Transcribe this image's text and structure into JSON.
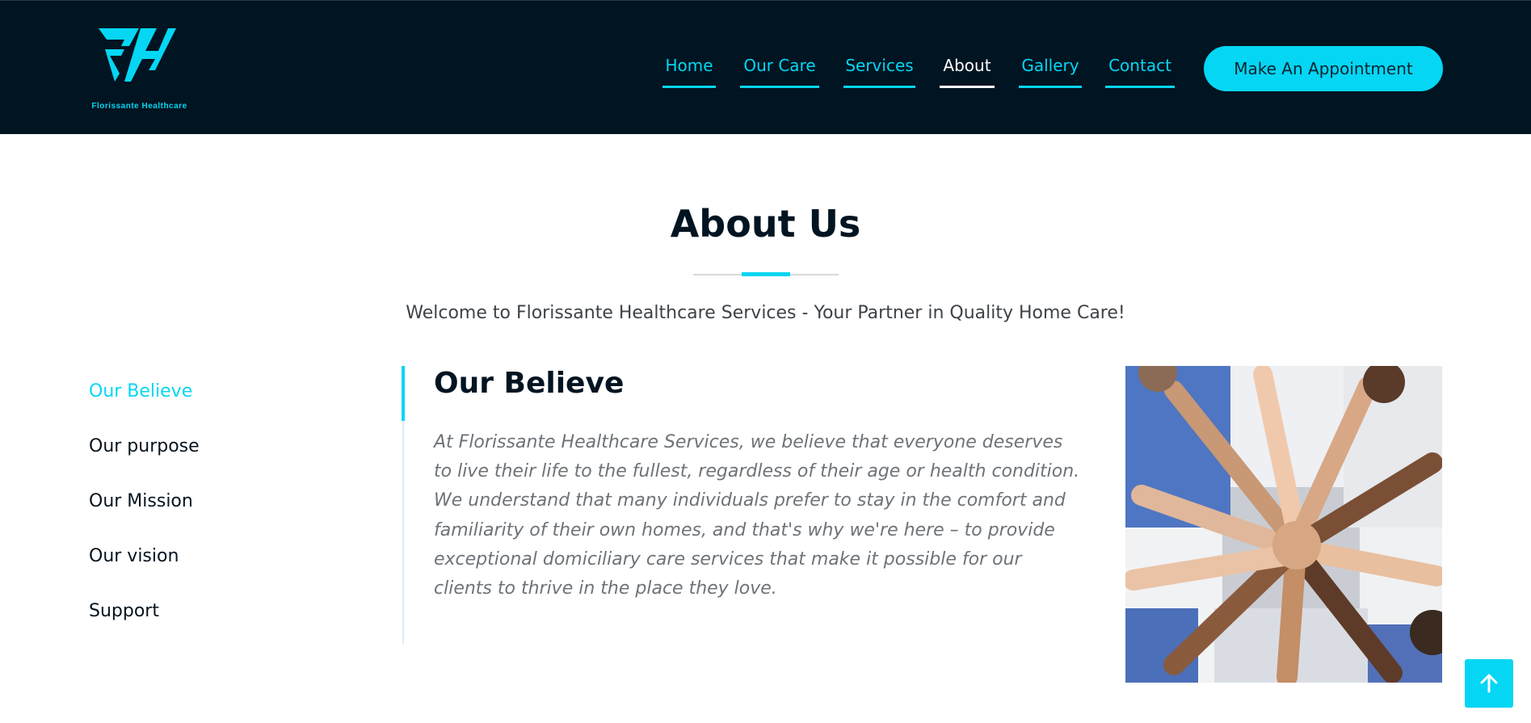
{
  "brand": {
    "logo_text": "Florissante Healthcare",
    "accent_color": "#04d6f3",
    "header_bg": "#011421"
  },
  "nav": {
    "items": [
      {
        "label": "Home",
        "active": false
      },
      {
        "label": "Our Care",
        "active": false
      },
      {
        "label": "Services",
        "active": false
      },
      {
        "label": "About",
        "active": true
      },
      {
        "label": "Gallery",
        "active": false
      },
      {
        "label": "Contact",
        "active": false
      }
    ],
    "appointment_label": "Make An Appointment"
  },
  "about": {
    "title": "About Us",
    "welcome": "Welcome to Florissante Healthcare Services - Your Partner in Quality Home Care!"
  },
  "side_menu": {
    "items": [
      {
        "label": "Our Believe",
        "active": true
      },
      {
        "label": "Our purpose",
        "active": false
      },
      {
        "label": "Our Mission",
        "active": false
      },
      {
        "label": "Our vision",
        "active": false
      },
      {
        "label": "Support",
        "active": false
      }
    ]
  },
  "content": {
    "title": "Our Believe",
    "text": "At Florissante Healthcare Services, we believe that everyone deserves to live their life to the fullest, regardless of their age or health condition. We understand that many individuals prefer to stay in the comfort and familiarity of their own homes, and that's why we're here – to provide exceptional domiciliary care services that make it possible for our clients to thrive in the place they love."
  },
  "icons": {
    "logo": "fh-logo-icon",
    "back_to_top": "arrow-up-icon",
    "photo": "team-hands-photo"
  }
}
